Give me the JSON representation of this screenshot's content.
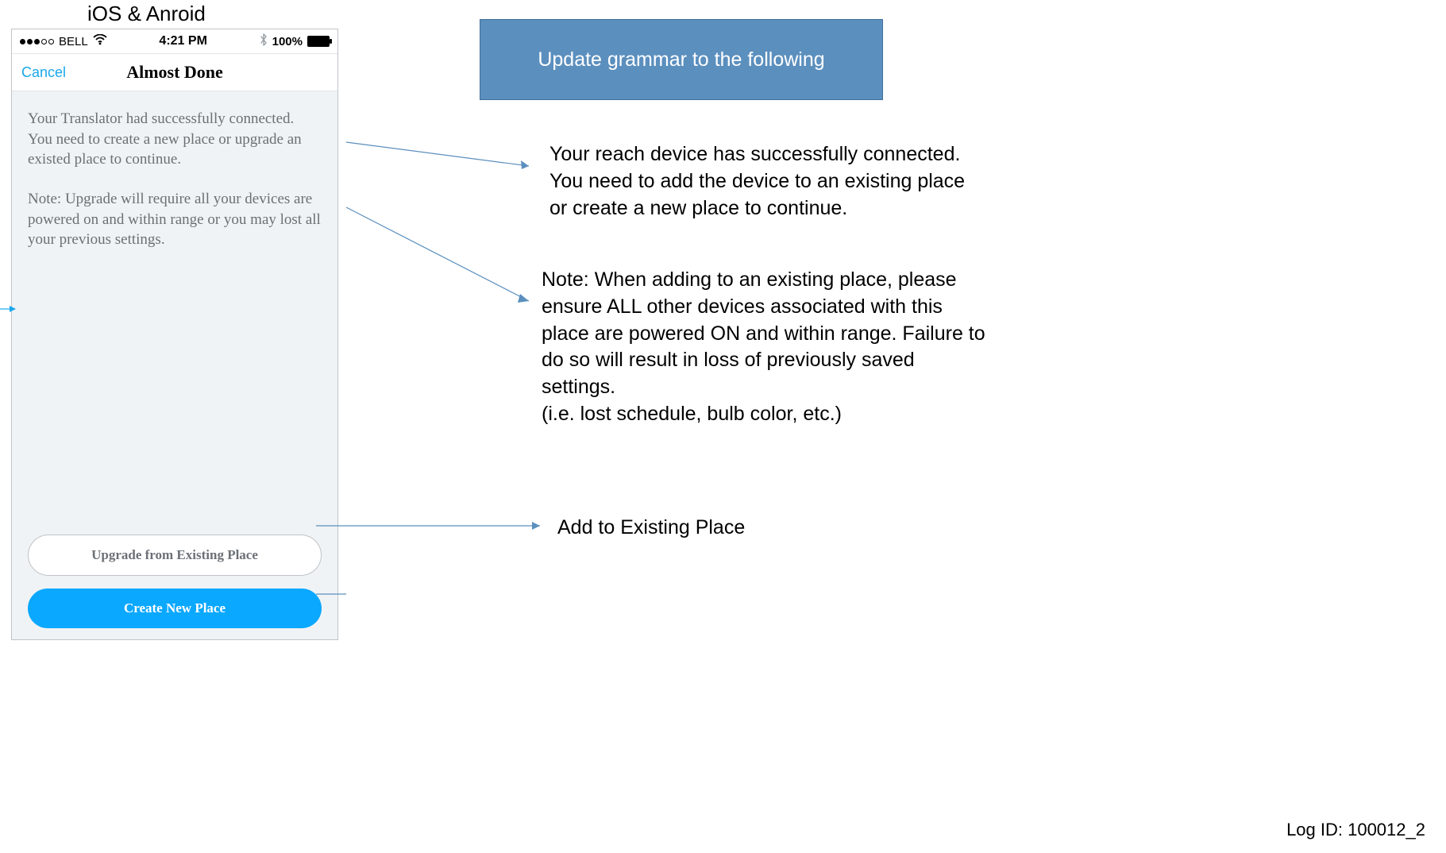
{
  "header_label": "iOS & Anroid",
  "phone": {
    "status": {
      "carrier": "BELL",
      "time": "4:21 PM",
      "battery_pct": "100%"
    },
    "nav": {
      "cancel": "Cancel",
      "title": "Almost Done"
    },
    "paragraph1": "Your Translator had successfully connected. You need to create a new place or upgrade an existed place to continue.",
    "paragraph2": "Note: Upgrade will require all your devices are powered on and within range or you may lost all your previous settings.",
    "btn_upgrade": "Upgrade from Existing Place",
    "btn_create": "Create New Place"
  },
  "banner": "Update grammar to the following",
  "revised": {
    "paragraph1": "Your reach device has successfully connected. You need to add the device to an existing place or create a new place to continue.",
    "paragraph2": "Note: When adding to an existing place, please ensure ALL other devices associated with this place are powered ON and within range. Failure to do so will result in loss of previously saved settings.\n(i.e. lost schedule, bulb color, etc.)",
    "button_label": "Add to Existing Place"
  },
  "log_id": "Log ID: 100012_2"
}
